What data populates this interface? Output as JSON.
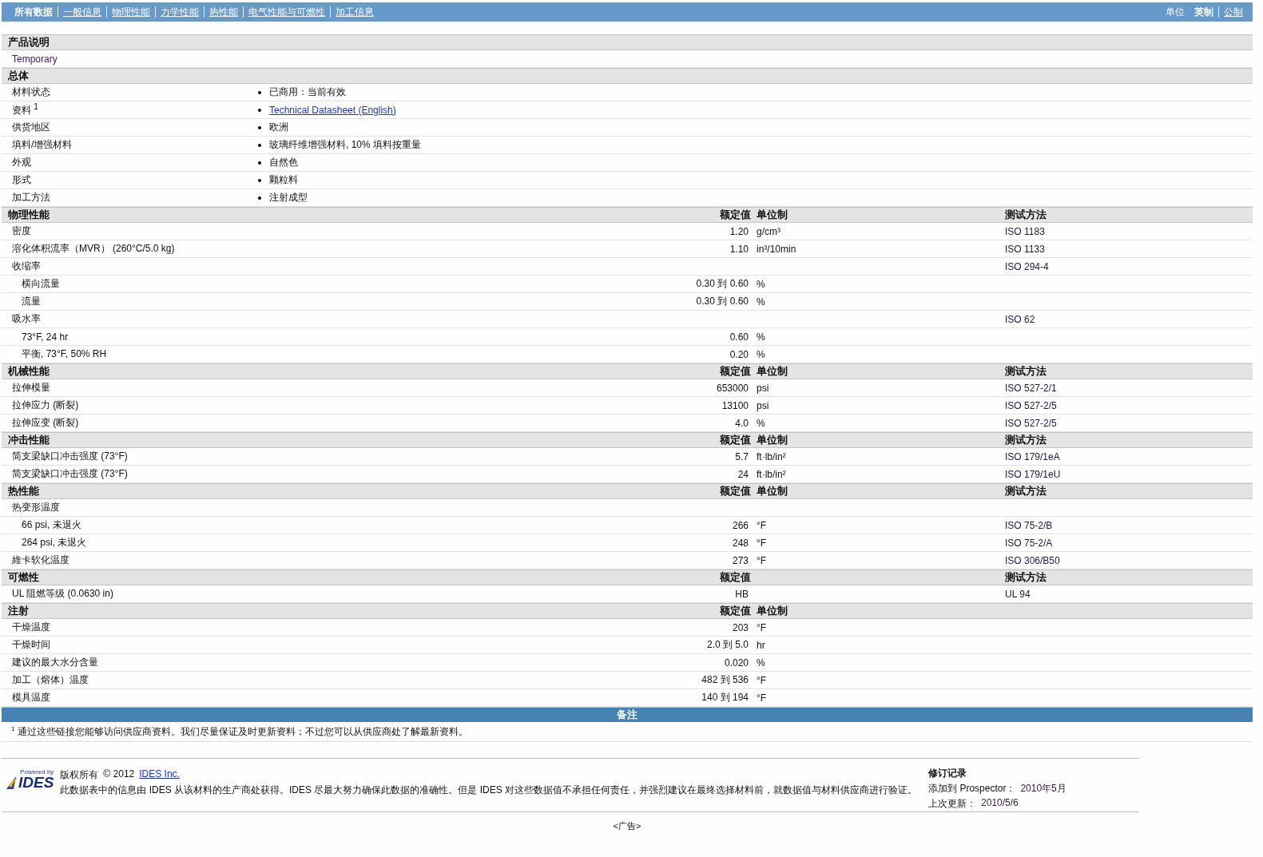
{
  "nav": {
    "tabs": [
      {
        "label": "所有数据",
        "selected": true
      },
      {
        "label": "一般信息",
        "selected": false
      },
      {
        "label": "物理性能",
        "selected": false
      },
      {
        "label": "力学性能",
        "selected": false
      },
      {
        "label": "热性能",
        "selected": false
      },
      {
        "label": "电气性能与可燃性",
        "selected": false
      },
      {
        "label": "加工信息",
        "selected": false
      }
    ],
    "units": {
      "label": "单位",
      "options": [
        {
          "label": "英制",
          "selected": true
        },
        {
          "label": "公制",
          "selected": false
        }
      ]
    }
  },
  "sections": [
    {
      "kind": "description",
      "title": "产品说明",
      "text": "Temporary"
    },
    {
      "kind": "general",
      "title": "总体",
      "rows": [
        {
          "label": "材料状态",
          "kind": "text",
          "value": "已商用：当前有效"
        },
        {
          "label": "资料 $^{1}$",
          "kind": "link",
          "value": "Technical Datasheet (English)"
        },
        {
          "label": "供货地区",
          "kind": "text",
          "value": "欧洲"
        },
        {
          "label": "填料/增强材料",
          "kind": "text",
          "value": "玻璃纤维增强材料, 10% 填料按重量"
        },
        {
          "label": "外观",
          "kind": "text",
          "value": "自然色"
        },
        {
          "label": "形式",
          "kind": "text",
          "value": "颗粒料"
        },
        {
          "label": "加工方法",
          "kind": "text",
          "value": "注射成型"
        }
      ]
    },
    {
      "kind": "properties",
      "title": "物理性能",
      "columns": {
        "value": "额定值",
        "unit": "单位制",
        "method": "测试方法"
      },
      "rows": [
        {
          "label": "密度",
          "value": "1.20",
          "unit": "g/cm³",
          "method": "ISO 1183"
        },
        {
          "label": "溶化体积流率（MVR） (260°C/5.0 kg)",
          "value": "1.10",
          "unit": "in³/10min",
          "method": "ISO 1133"
        },
        {
          "label": "收缩率",
          "method": "ISO 294-4",
          "children": [
            {
              "label": "横向流量",
              "value": "0.30 到 0.60",
              "unit": "%"
            },
            {
              "label": "流量",
              "value": "0.30 到 0.60",
              "unit": "%"
            }
          ]
        },
        {
          "label": "吸水率",
          "method": "ISO 62",
          "children": [
            {
              "label": "73°F, 24 hr",
              "value": "0.60",
              "unit": "%"
            },
            {
              "label": "平衡, 73°F, 50% RH",
              "value": "0.20",
              "unit": "%"
            }
          ]
        }
      ]
    },
    {
      "kind": "properties",
      "title": "机械性能",
      "columns": {
        "value": "额定值",
        "unit": "单位制",
        "method": "测试方法"
      },
      "rows": [
        {
          "label": "拉伸模量",
          "value": "653000",
          "unit": "psi",
          "method": "ISO 527-2/1"
        },
        {
          "label": "拉伸应力 (断裂)",
          "value": "13100",
          "unit": "psi",
          "method": "ISO 527-2/5"
        },
        {
          "label": "拉伸应变 (断裂)",
          "value": "4.0",
          "unit": "%",
          "method": "ISO 527-2/5"
        }
      ]
    },
    {
      "kind": "properties",
      "title": "冲击性能",
      "columns": {
        "value": "额定值",
        "unit": "单位制",
        "method": "测试方法"
      },
      "rows": [
        {
          "label": "简支梁缺口冲击强度 (73°F)",
          "value": "5.7",
          "unit": "ft·lb/in²",
          "method": "ISO 179/1eA"
        },
        {
          "label": "简支梁缺口冲击强度 (73°F)",
          "value": "24",
          "unit": "ft·lb/in²",
          "method": "ISO 179/1eU"
        }
      ]
    },
    {
      "kind": "properties",
      "title": "热性能",
      "columns": {
        "value": "额定值",
        "unit": "单位制",
        "method": "测试方法"
      },
      "rows": [
        {
          "label": "热变形温度",
          "children": [
            {
              "label": "66 psi, 未退火",
              "value": "266",
              "unit": "°F",
              "method": "ISO 75-2/B"
            },
            {
              "label": "264 psi, 未退火",
              "value": "248",
              "unit": "°F",
              "method": "ISO 75-2/A"
            }
          ]
        },
        {
          "label": "維卡软化温度",
          "value": "273",
          "unit": "°F",
          "method": "ISO 306/B50"
        }
      ]
    },
    {
      "kind": "properties",
      "title": "可燃性",
      "columns": {
        "value": "额定值",
        "method": "测试方法"
      },
      "rows": [
        {
          "label": "UL 阻燃等级 (0.0630 in)",
          "value": "HB",
          "method": "UL 94"
        }
      ]
    },
    {
      "kind": "properties",
      "title": "注射",
      "columns": {
        "value": "额定值",
        "unit": "单位制"
      },
      "rows": [
        {
          "label": "干燥温度",
          "value": "203",
          "unit": "°F"
        },
        {
          "label": "干燥时间",
          "value": "2.0 到 5.0",
          "unit": "hr"
        },
        {
          "label": "建议的最大水分含量",
          "value": "0.020",
          "unit": "%"
        },
        {
          "label": "加工（熔体）温度",
          "value": "482 到 536",
          "unit": "°F"
        },
        {
          "label": "模具温度",
          "value": "140 到 194",
          "unit": "°F"
        }
      ]
    }
  ],
  "notes": {
    "title": "备注",
    "items": [
      "$^{1}$ 通过这些链接您能够访问供应商资料。我们尽量保证及时更新资料；不过您可以从供应商处了解最新资料。"
    ]
  },
  "footer": {
    "logo": {
      "caption": "Powered by",
      "wordmark": "IDES"
    },
    "copyright": {
      "label": "版权所有",
      "year": "© 2012",
      "link": "IDES Inc."
    },
    "disclaimer": "此数据表中的信息由 IDES 从该材料的生产商处获得。IDES 尽最大努力确保此数据的准确性。但是 IDES 对这些数据值不承担任何责任，并强烈建议在最终选择材料前，就数据值与材料供应商进行验证。",
    "revision": {
      "title": "修订记录",
      "added_label": "添加到 Prospector：",
      "added": "2010年5月",
      "updated_label": "上次更新：",
      "updated": "2010/5/6"
    }
  },
  "ad": "<广告>"
}
